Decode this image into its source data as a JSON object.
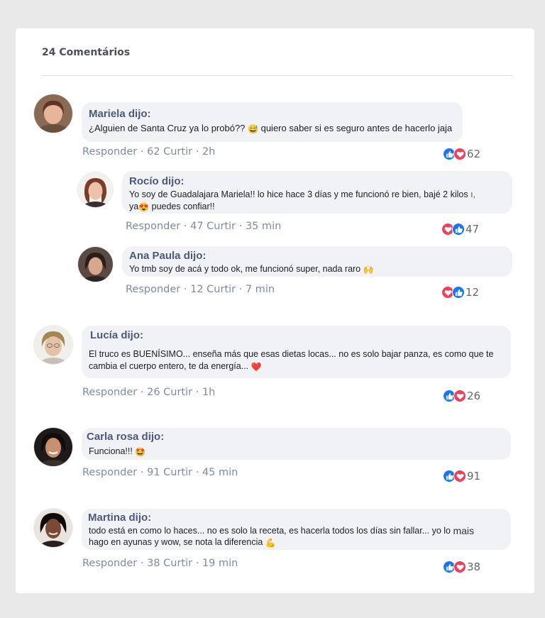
{
  "header": {
    "count_label": "24 Comentários"
  },
  "colors": {
    "like": "#1877f2",
    "love": "#f33e58",
    "bubble": "#f0f2f5",
    "author": "#4a5a78",
    "action": "#7f8ba0"
  },
  "actions": {
    "reply": "Responder",
    "like": "Curtir",
    "sep": "·"
  },
  "comments": [
    {
      "author": "Mariela dijo:",
      "text_a": "¿Alguien de Santa Cruz ya lo probó?? ",
      "emoji_a": "😅",
      "text_b": " quiero saber si es seguro antes de hacerlo jaja",
      "likes": "62",
      "time": "2h",
      "reactions": "62",
      "reaction_icons": [
        "like-icon",
        "love-icon"
      ]
    },
    {
      "author": "Rocío dijo:",
      "text_a": "Yo soy de Guadalajara Mariela!! lo hice hace 3 días y me funcionó re bien, bajé 2 kilos ",
      "stray": "ı,",
      "text_b": "ya",
      "emoji_a": "😍",
      "text_c": " puedes confiar!!",
      "likes": "47",
      "time": "35 min",
      "reactions": "47",
      "reaction_icons": [
        "love-icon",
        "like-icon"
      ]
    },
    {
      "author": "Ana Paula dijo:",
      "text_a": "Yo tmb soy de acá y todo ok, me funcionó super, nada raro ",
      "emoji_a": "🙌",
      "likes": "12",
      "time": "7 min",
      "reactions": "12",
      "reaction_icons": [
        "love-icon",
        "like-icon"
      ]
    },
    {
      "author": "Lucía dijo:",
      "text_a": "El truco es BUENÍSIMO... enseña más que esas dietas locas... no es solo bajar panza, es como que te cambia el cuerpo entero, te da energía... ",
      "emoji_a": "❤️",
      "likes": "26",
      "time": "1h",
      "reactions": "26",
      "reaction_icons": [
        "like-icon",
        "love-icon"
      ]
    },
    {
      "author": "Carla rosa dijo:",
      "text_a": "Funciona!!! ",
      "emoji_a": "🤩",
      "likes": "91",
      "time": "45 min",
      "reactions": "91",
      "reaction_icons": [
        "like-icon",
        "love-icon"
      ]
    },
    {
      "author": "Martina dijo:",
      "text_a": "todo está en como lo haces... no es solo la receta, es hacerla todos los días sin fallar... yo lo ",
      "text_big": "mais",
      "text_b": "hago en ayunas y wow, se nota la diferencia ",
      "emoji_a": "💪",
      "likes": "38",
      "time": "19 min",
      "reactions": "38",
      "reaction_icons": [
        "like-icon",
        "love-icon"
      ]
    }
  ]
}
